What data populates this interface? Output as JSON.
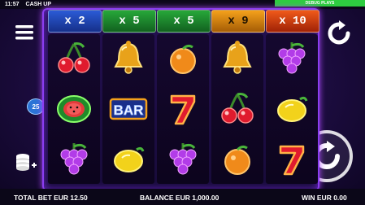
{
  "status": {
    "time": "11:57",
    "app_title": "CASH UP",
    "debug_label": "DEBUG PLAYS"
  },
  "multipliers": [
    "x 2",
    "x 5",
    "x 5",
    "x 9",
    "x 10"
  ],
  "reels": [
    [
      "cherries",
      "watermelon",
      "grapes"
    ],
    [
      "bell",
      "bar",
      "lemon"
    ],
    [
      "orange",
      "seven",
      "grapes"
    ],
    [
      "bell",
      "cherries",
      "orange"
    ],
    [
      "grapes",
      "lemon",
      "seven"
    ]
  ],
  "paylines": "25",
  "footer": {
    "total_bet": "TOTAL BET EUR 12.50",
    "balance": "BALANCE EUR 1,000.00",
    "win": "WIN EUR 0.00"
  },
  "bar_text": "BAR",
  "colors": {
    "frame": "#8b3df0",
    "spin": "#ffffff"
  }
}
